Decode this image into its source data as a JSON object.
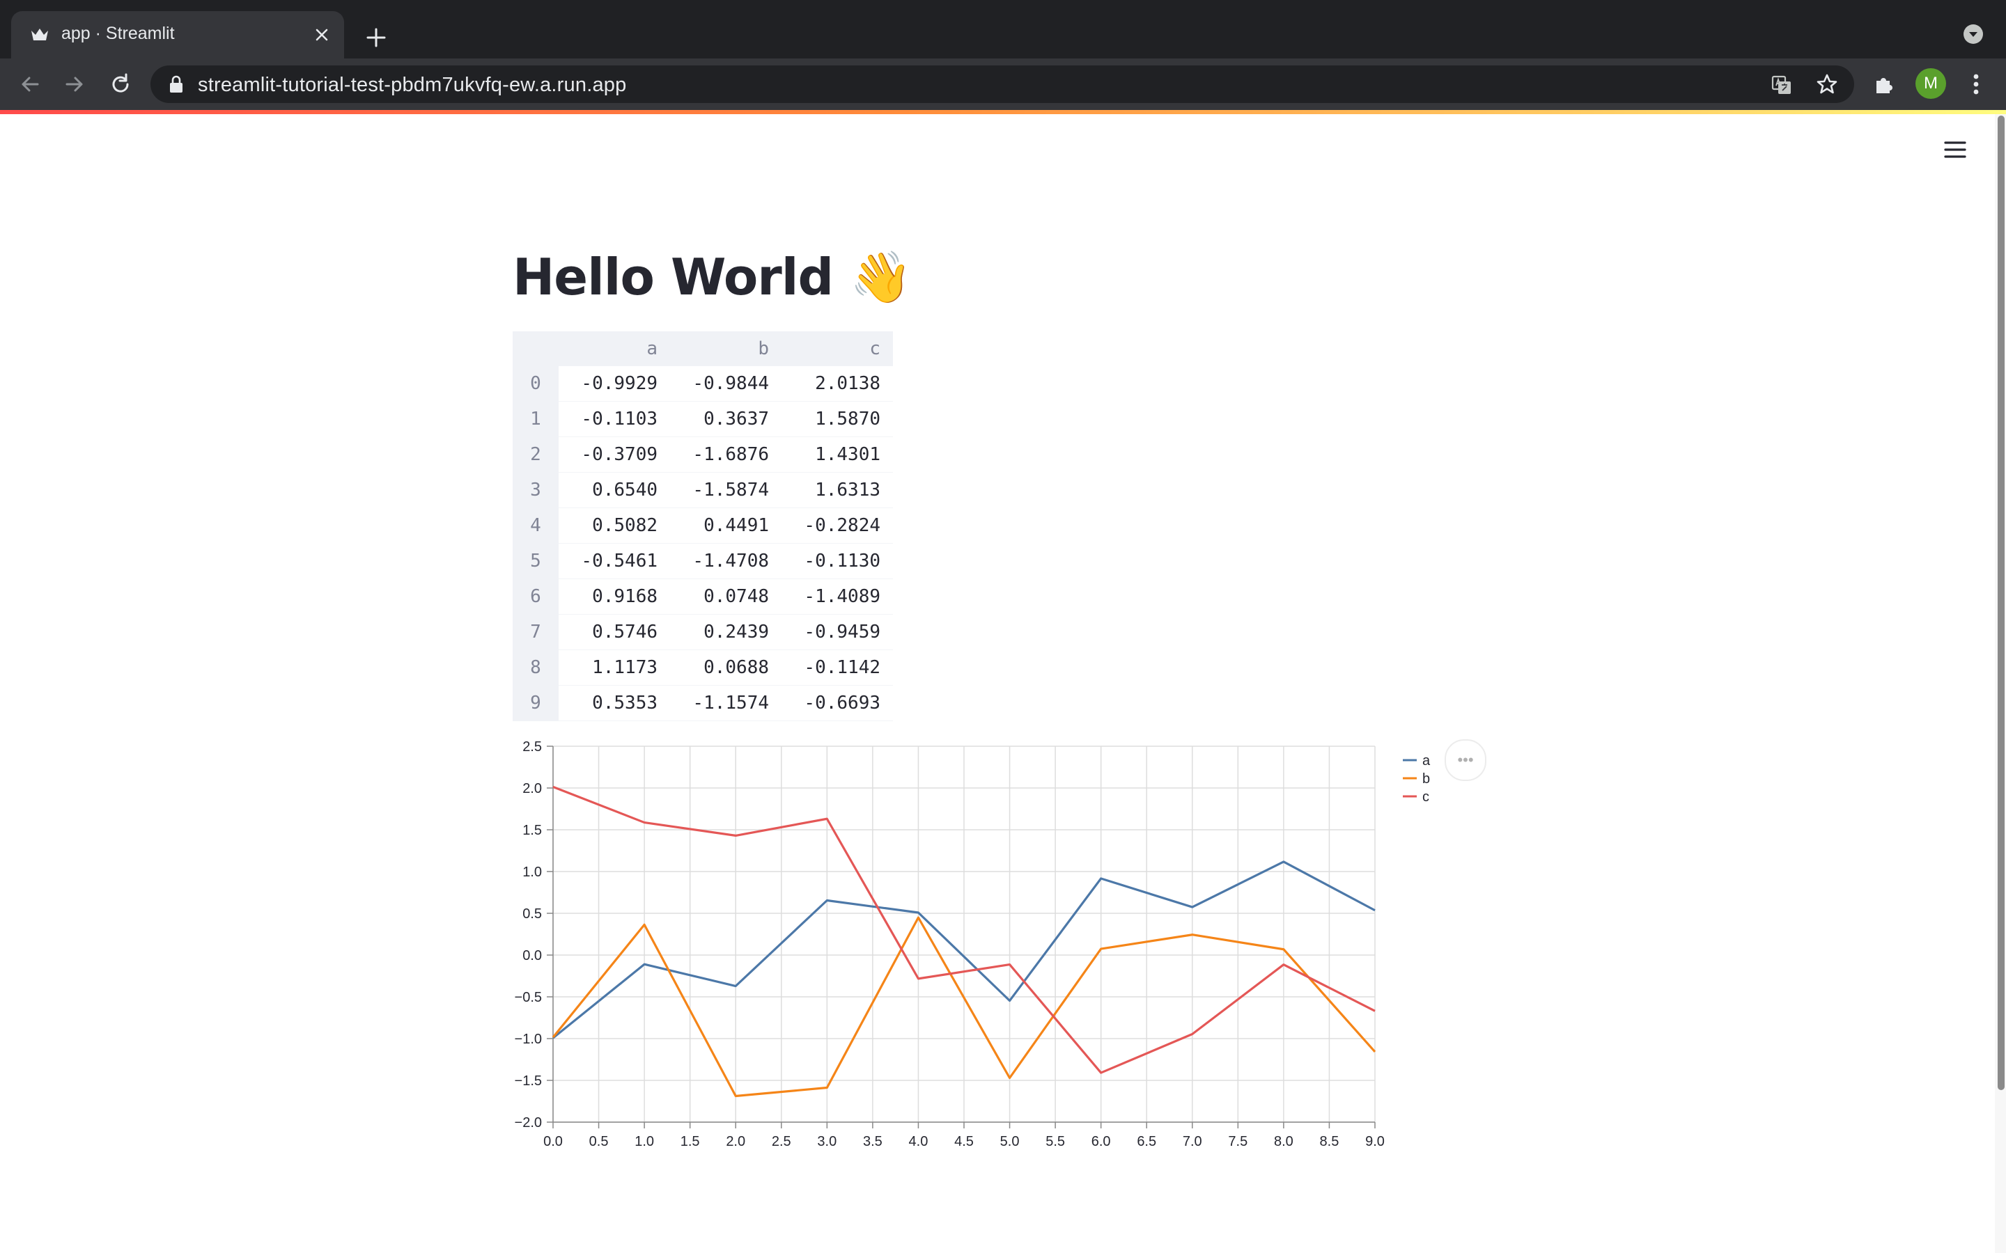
{
  "browser": {
    "tab_title": "app · Streamlit",
    "url": "streamlit-tutorial-test-pbdm7ukvfq-ew.a.run.app",
    "avatar_letter": "M",
    "accent_colors": {
      "chrome_dark": "#202124",
      "chrome_tab": "#35363a",
      "decoration_start": "#ff4b4b",
      "decoration_end": "#fffd80"
    }
  },
  "app": {
    "title": "Hello World",
    "title_emoji": "👋"
  },
  "dataframe": {
    "columns": [
      "a",
      "b",
      "c"
    ],
    "index": [
      "0",
      "1",
      "2",
      "3",
      "4",
      "5",
      "6",
      "7",
      "8",
      "9"
    ],
    "rows": [
      [
        "-0.9929",
        "-0.9844",
        "2.0138"
      ],
      [
        "-0.1103",
        "0.3637",
        "1.5870"
      ],
      [
        "-0.3709",
        "-1.6876",
        "1.4301"
      ],
      [
        "0.6540",
        "-1.5874",
        "1.6313"
      ],
      [
        "0.5082",
        "0.4491",
        "-0.2824"
      ],
      [
        "-0.5461",
        "-1.4708",
        "-0.1130"
      ],
      [
        "0.9168",
        "0.0748",
        "-1.4089"
      ],
      [
        "0.5746",
        "0.2439",
        "-0.9459"
      ],
      [
        "1.1173",
        "0.0688",
        "-0.1142"
      ],
      [
        "0.5353",
        "-1.1574",
        "-0.6693"
      ]
    ]
  },
  "chart_data": {
    "type": "line",
    "x": [
      0,
      1,
      2,
      3,
      4,
      5,
      6,
      7,
      8,
      9
    ],
    "series": [
      {
        "name": "a",
        "color": "#4c78a8",
        "values": [
          -0.9929,
          -0.1103,
          -0.3709,
          0.654,
          0.5082,
          -0.5461,
          0.9168,
          0.5746,
          1.1173,
          0.5353
        ]
      },
      {
        "name": "b",
        "color": "#f58518",
        "values": [
          -0.9844,
          0.3637,
          -1.6876,
          -1.5874,
          0.4491,
          -1.4708,
          0.0748,
          0.2439,
          0.0688,
          -1.1574
        ]
      },
      {
        "name": "c",
        "color": "#e45756",
        "values": [
          2.0138,
          1.587,
          1.4301,
          1.6313,
          -0.2824,
          -0.113,
          -1.4089,
          -0.9459,
          -0.1142,
          -0.6693
        ]
      }
    ],
    "xlim": [
      0,
      9
    ],
    "ylim": [
      -2.0,
      2.5
    ],
    "x_ticks": [
      "0.0",
      "0.5",
      "1.0",
      "1.5",
      "2.0",
      "2.5",
      "3.0",
      "3.5",
      "4.0",
      "4.5",
      "5.0",
      "5.5",
      "6.0",
      "6.5",
      "7.0",
      "7.5",
      "8.0",
      "8.5",
      "9.0"
    ],
    "y_ticks": [
      "2.5",
      "2.0",
      "1.5",
      "1.0",
      "0.5",
      "0.0",
      "−0.5",
      "−1.0",
      "−1.5",
      "−2.0"
    ],
    "grid": true,
    "legend_position": "top-right",
    "menu_label": "•••"
  }
}
